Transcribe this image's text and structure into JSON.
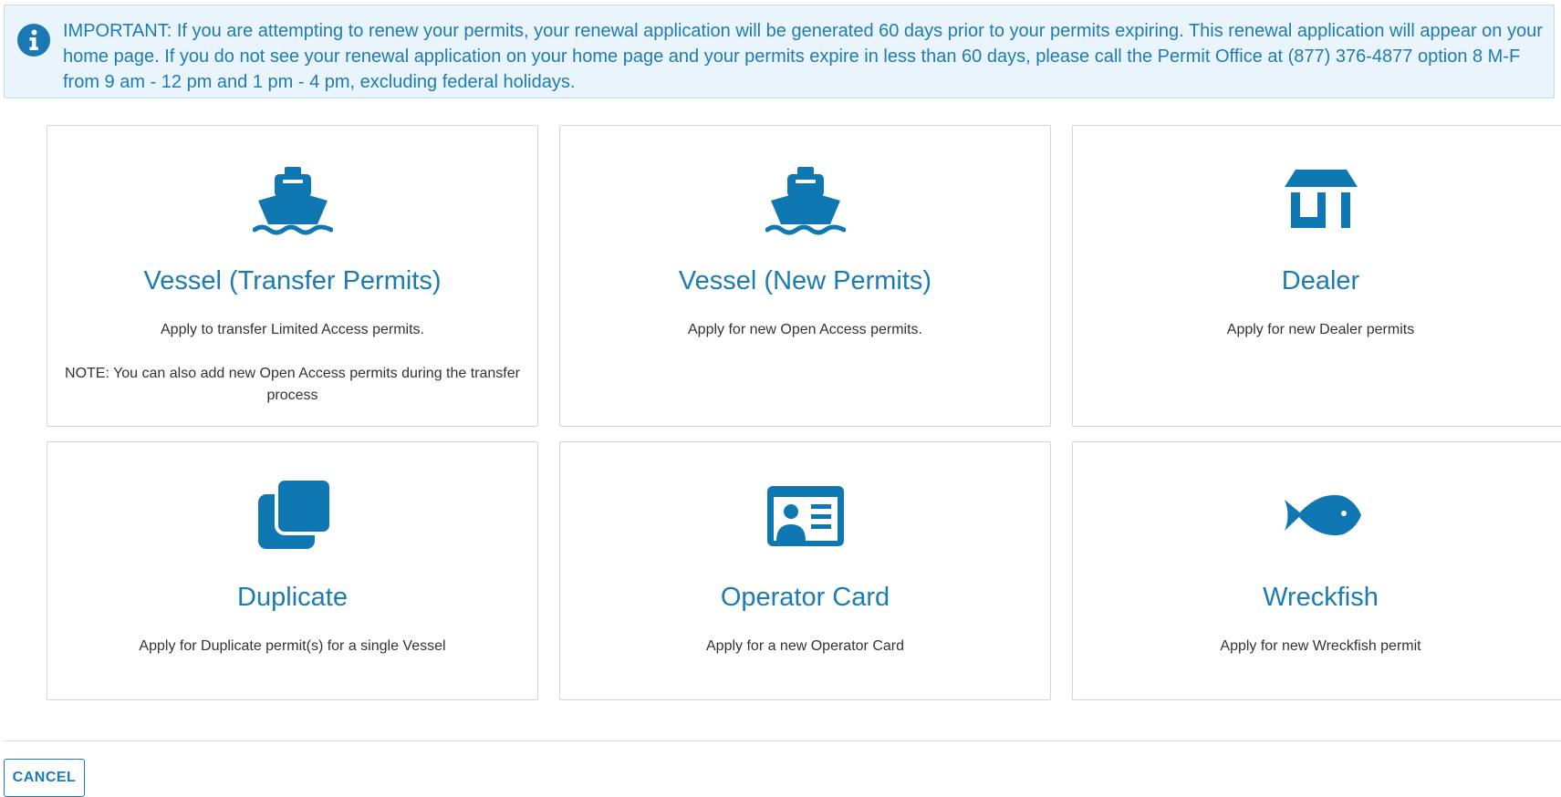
{
  "alert": {
    "icon": "info-circle-icon",
    "text": "IMPORTANT: If you are attempting to renew your permits, your renewal application will be generated 60 days prior to your permits expiring. This renewal application will appear on your home page. If you do not see your renewal application on your home page and your permits expire in less than 60 days, please call the Permit Office at (877) 376-4877 option 8 M-F from 9 am - 12 pm and 1 pm - 4 pm, excluding federal holidays."
  },
  "cards": [
    {
      "icon": "ship-icon",
      "title": "Vessel (Transfer Permits)",
      "description": "Apply to transfer Limited Access permits.",
      "note": "NOTE: You can also add new Open Access permits during the transfer process"
    },
    {
      "icon": "ship-icon",
      "title": "Vessel (New Permits)",
      "description": "Apply for new Open Access permits."
    },
    {
      "icon": "store-icon",
      "title": "Dealer",
      "description": "Apply for new Dealer permits"
    },
    {
      "icon": "copy-icon",
      "title": "Duplicate",
      "description": "Apply for Duplicate permit(s) for a single Vessel"
    },
    {
      "icon": "id-card-icon",
      "title": "Operator Card",
      "description": "Apply for a new Operator Card"
    },
    {
      "icon": "fish-icon",
      "title": "Wreckfish",
      "description": "Apply for new Wreckfish permit"
    }
  ],
  "footer": {
    "cancel_label": "CANCEL"
  },
  "colors": {
    "accent": "#1b7bb4",
    "alert_background": "#eaf4fc",
    "alert_text": "#1e7bb5",
    "card_border": "#d6d6d6"
  }
}
